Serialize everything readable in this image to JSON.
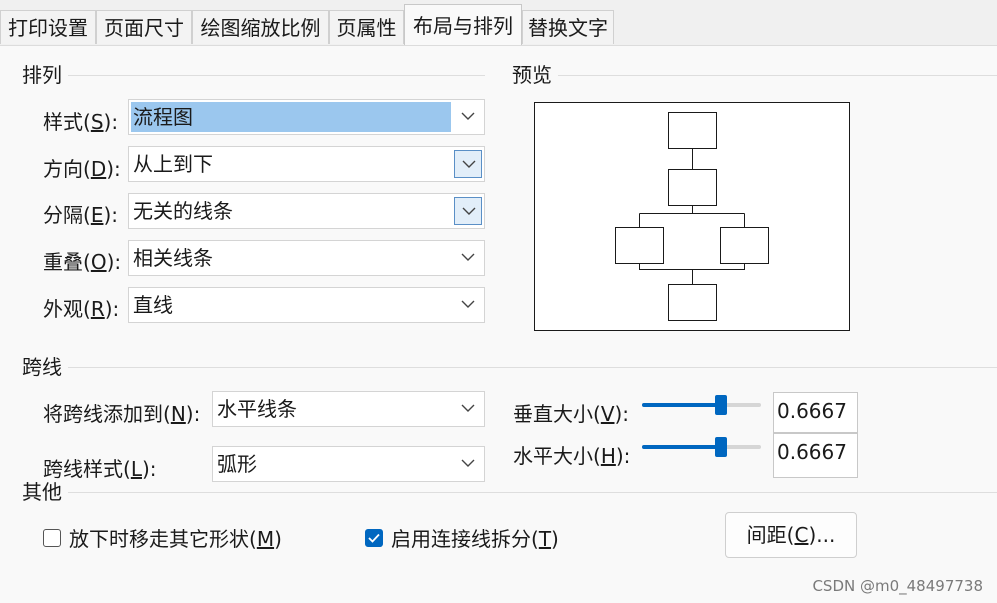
{
  "tabs": [
    "打印设置",
    "页面尺寸",
    "绘图缩放比例",
    "页属性",
    "布局与排列",
    "替换文字"
  ],
  "active_tab": "布局与排列",
  "arrange": {
    "title": "排列",
    "style": {
      "label": "样式(",
      "key": "S",
      "tail": "):",
      "value": "流程图"
    },
    "direction": {
      "label": "方向(",
      "key": "D",
      "tail": "):",
      "value": "从上到下"
    },
    "separation": {
      "label": "分隔(",
      "key": "E",
      "tail": "):",
      "value": "无关的线条"
    },
    "overlap": {
      "label": "重叠(",
      "key": "O",
      "tail": "):",
      "value": "相关线条"
    },
    "appearance": {
      "label": "外观(",
      "key": "R",
      "tail": "):",
      "value": "直线"
    }
  },
  "preview": {
    "title": "预览"
  },
  "jumps": {
    "title": "跨线",
    "add_to": {
      "label": "将跨线添加到(",
      "key": "N",
      "tail": "):",
      "value": "水平线条"
    },
    "style": {
      "label": "跨线样式(",
      "key": "L",
      "tail": "):",
      "value": "弧形"
    },
    "vertical": {
      "label": "垂直大小(",
      "key": "V",
      "tail": "):",
      "value": "0.6667",
      "level": 0.6667
    },
    "horizontal": {
      "label": "水平大小(",
      "key": "H",
      "tail": "):",
      "value": "0.6667",
      "level": 0.6667
    }
  },
  "other": {
    "title": "其他",
    "move_away": {
      "label": "放下时移走其它形状(",
      "key": "M",
      "tail": ")",
      "checked": false
    },
    "split": {
      "label": "启用连接线拆分(",
      "key": "T",
      "tail": ")",
      "checked": true
    },
    "spacing_button": {
      "label": "间距(",
      "key": "C",
      "tail": ")..."
    }
  },
  "watermark": "CSDN @m0_48497738",
  "colors": {
    "accent": "#0067c0",
    "selection": "#9bc7ee"
  }
}
